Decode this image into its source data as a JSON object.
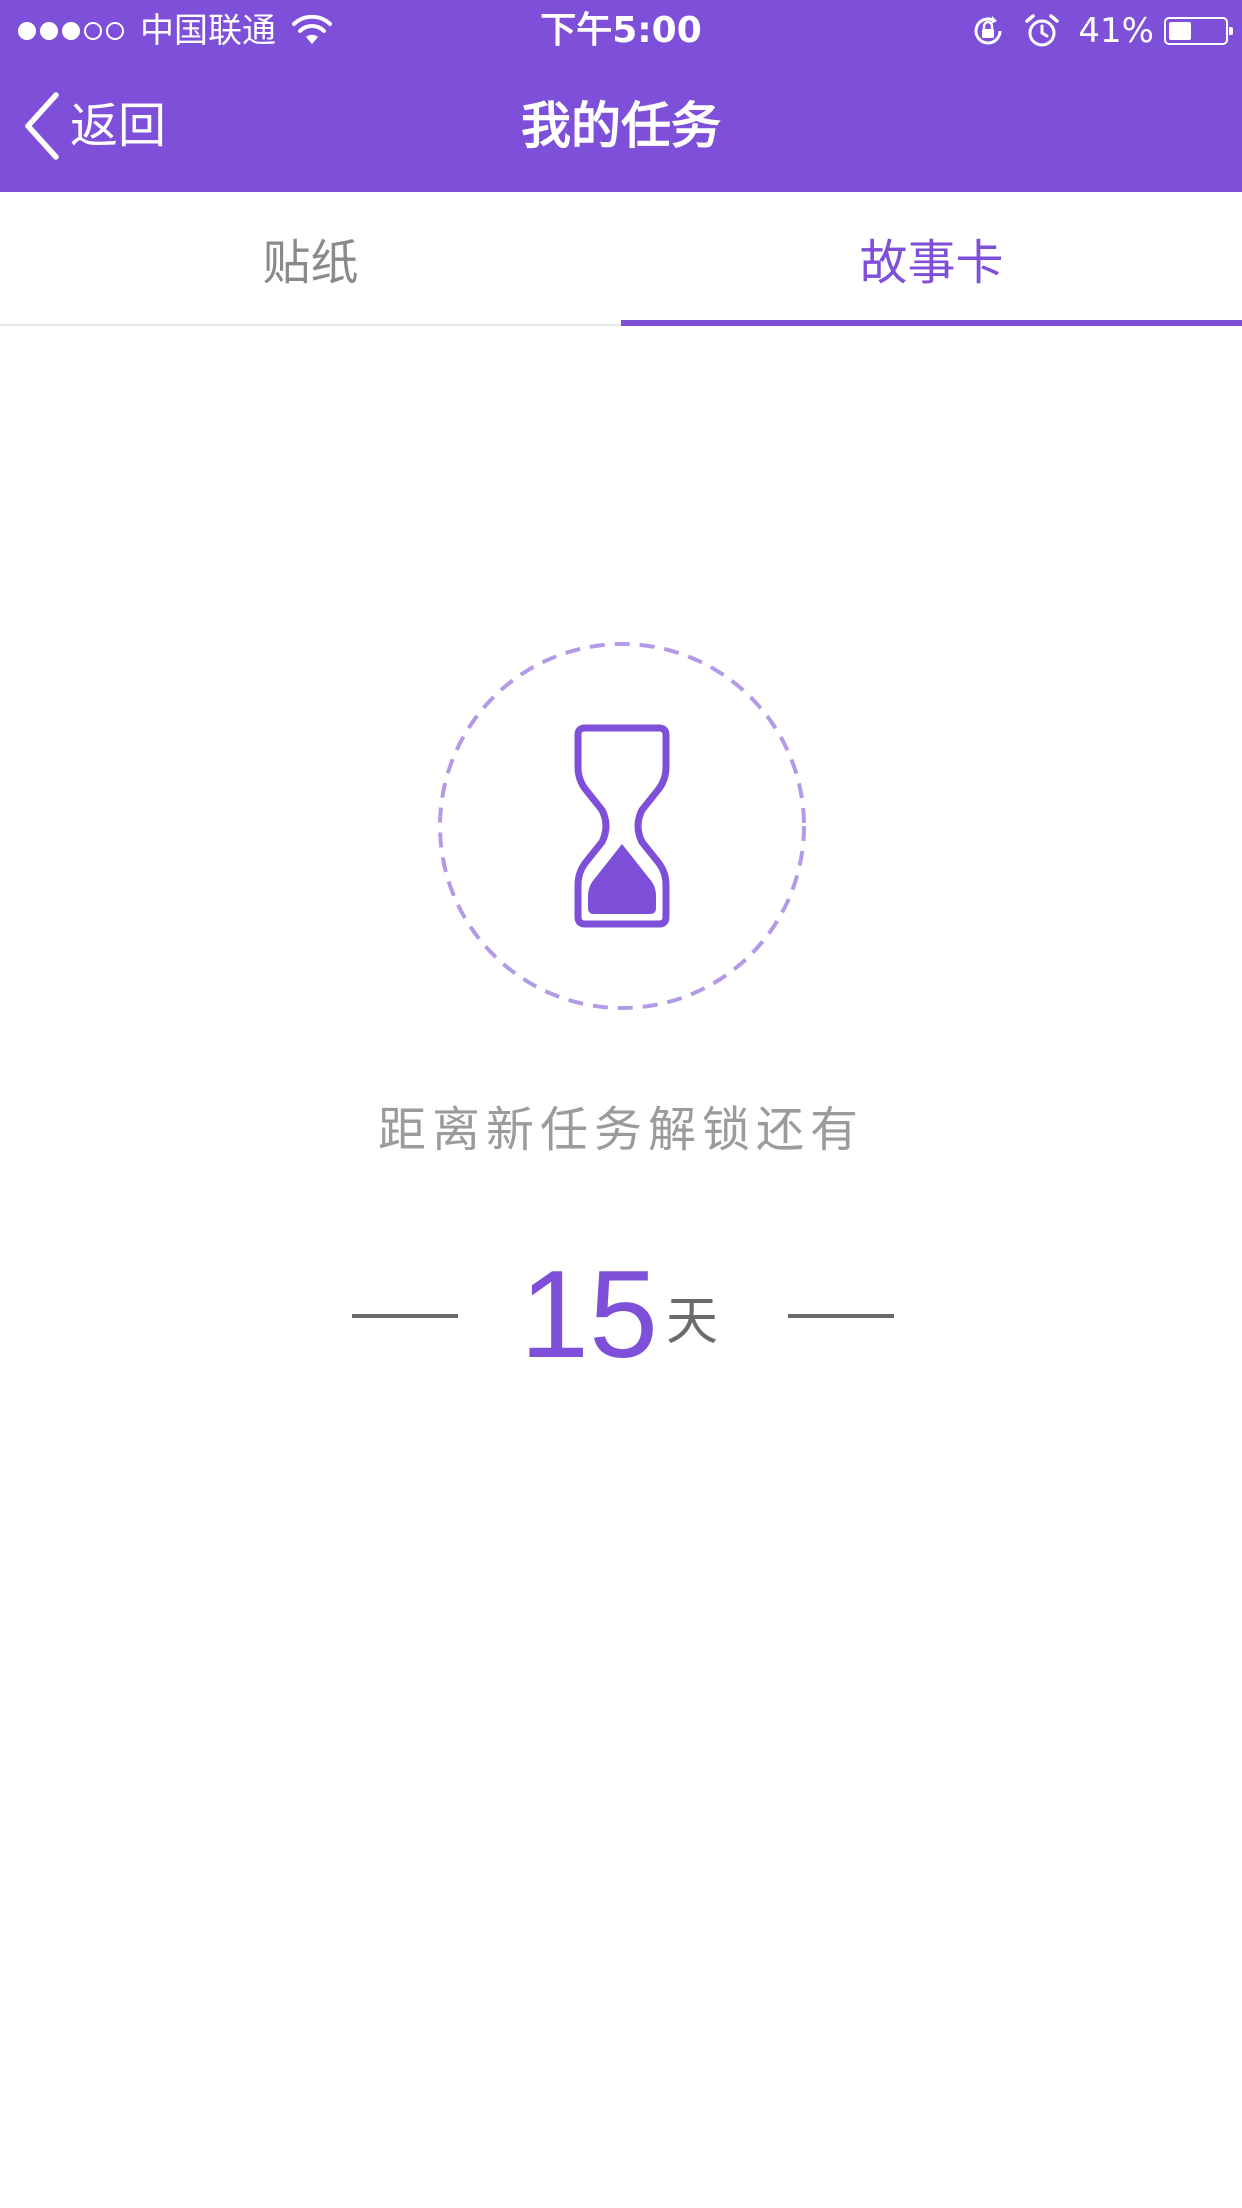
{
  "status_bar": {
    "carrier": "中国联通",
    "time": "下午5:00",
    "battery_percent": "41%",
    "battery_level": 0.41,
    "signal_strength": 3,
    "signal_max": 5
  },
  "nav": {
    "back_label": "返回",
    "title": "我的任务"
  },
  "tabs": [
    {
      "label": "贴纸",
      "active": false
    },
    {
      "label": "故事卡",
      "active": true
    }
  ],
  "countdown": {
    "caption": "距离新任务解锁还有",
    "number": "15",
    "unit": "天"
  },
  "icons": {
    "hourglass": "hourglass-icon",
    "back": "chevron-left-icon"
  },
  "colors": {
    "accent": "#7e4fd9",
    "dashed_circle": "#b39ae6",
    "caption_text": "#9b9b9b",
    "tab_inactive": "#8a8a8a"
  }
}
